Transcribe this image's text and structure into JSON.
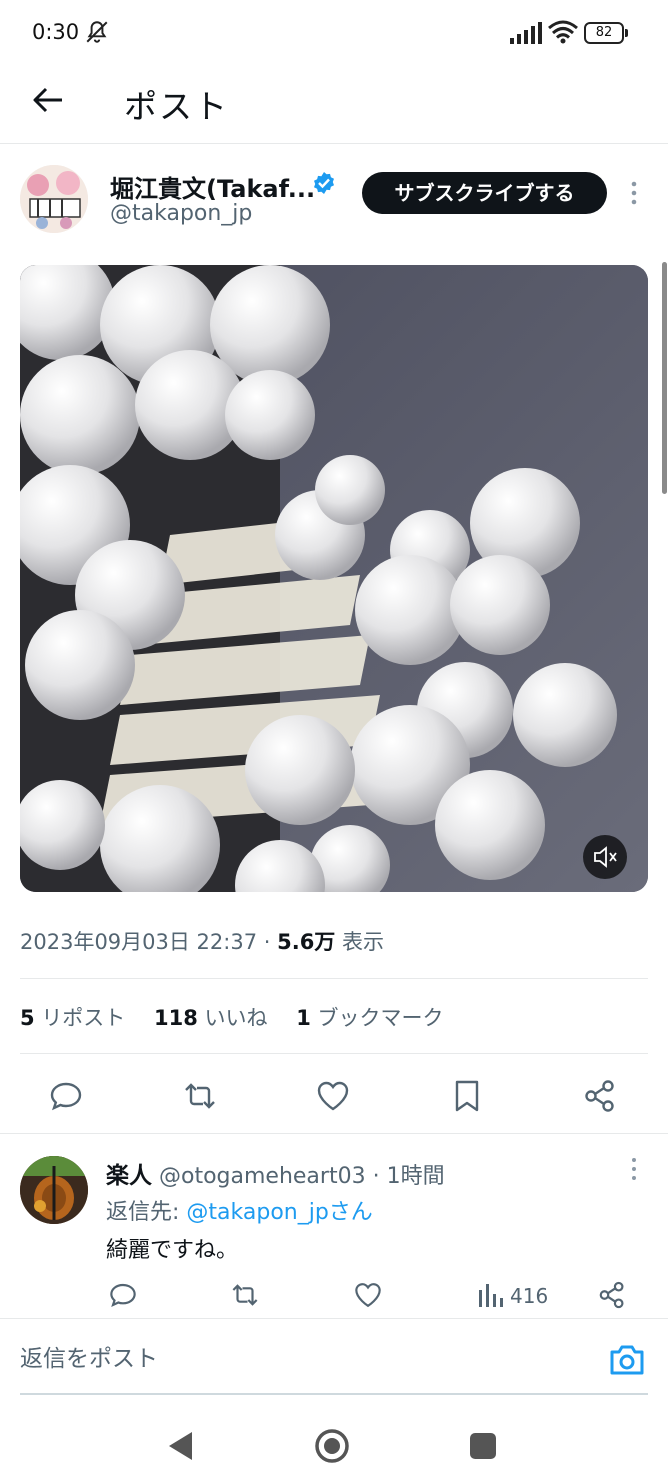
{
  "status_bar": {
    "time": "0:30",
    "battery": "82",
    "icons": [
      "mute-icon",
      "signal-icon",
      "wifi-icon",
      "battery-icon"
    ]
  },
  "header": {
    "title": "ポスト",
    "back_icon": "arrow-left-icon"
  },
  "author": {
    "name": "堀江貴文(Takaf...",
    "handle": "@takapon_jp",
    "subscribe_label": "サブスクライブする",
    "verified": true
  },
  "meta": {
    "datetime": "2023年09月03日 22:37 · ",
    "views_count": "5.6万",
    "views_label": " 表示"
  },
  "stats": {
    "reposts_count": "5",
    "reposts_label": "リポスト",
    "likes_count": "118",
    "likes_label": "いいね",
    "bookmarks_count": "1",
    "bookmarks_label": "ブックマーク"
  },
  "reply": {
    "name": "楽人",
    "handle": "@otogameheart03",
    "time": " · 1時間",
    "reply_to_prefix": "返信先: ",
    "reply_to_handle": "@takapon_jpさん",
    "text": "綺麗ですね。",
    "views": "416"
  },
  "compose": {
    "placeholder": "返信をポスト"
  },
  "colors": {
    "accent": "#1d9bf0",
    "text_primary": "#0f1419",
    "text_secondary": "#536471",
    "divider": "#e7e9ea",
    "button_dark": "#0f1419"
  }
}
